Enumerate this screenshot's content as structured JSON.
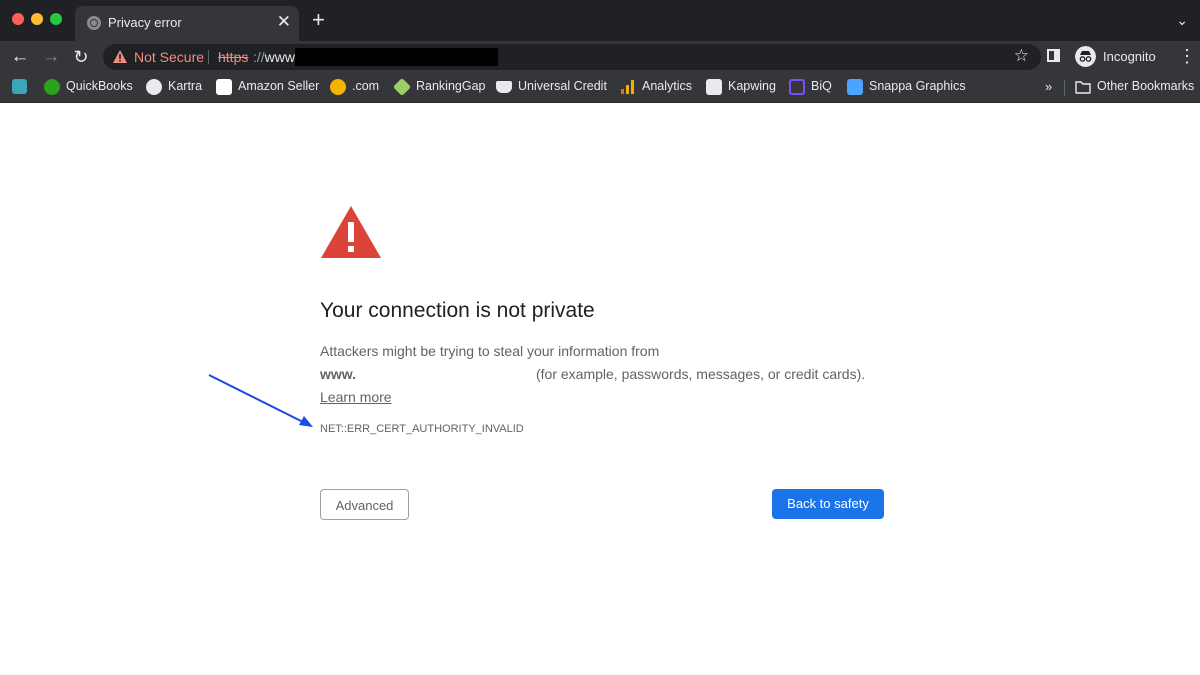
{
  "tab": {
    "title": "Privacy error",
    "close": "✕",
    "new_tab": "+",
    "tab_search": "⌄"
  },
  "toolbar": {
    "not_secure": "Not Secure",
    "url_scheme": "https",
    "url_sep": "://",
    "url_host": "www.",
    "incognito": "Incognito"
  },
  "bookmarks": {
    "items": [
      {
        "label": "",
        "icon": "app-icon",
        "color": "#3aa6b9"
      },
      {
        "label": "QuickBooks",
        "icon": "quickbooks-icon",
        "color": "#2ca01c"
      },
      {
        "label": "Kartra",
        "icon": "kartra-icon",
        "color": "#e8eaed"
      },
      {
        "label": "Amazon Seller",
        "icon": "amazon-icon",
        "color": "#ffffff"
      },
      {
        "label": ".com",
        "icon": "globe-icon",
        "color": "#f4b400"
      },
      {
        "label": "RankingGap",
        "icon": "rankinggap-icon",
        "color": "#9ccc65"
      },
      {
        "label": "Universal Credit",
        "icon": "crown-icon",
        "color": "#e8eaed"
      },
      {
        "label": "Analytics",
        "icon": "analytics-icon",
        "color": "#f9ab00"
      },
      {
        "label": "Kapwing",
        "icon": "kapwing-icon",
        "color": "#e8eaed"
      },
      {
        "label": "BiQ",
        "icon": "biq-icon",
        "color": "#7c4dff"
      },
      {
        "label": "Snappa Graphics",
        "icon": "snappa-icon",
        "color": "#4da3ff"
      }
    ],
    "more": "»",
    "other": "Other Bookmarks"
  },
  "page": {
    "heading": "Your connection is not private",
    "desc_line1": "Attackers might be trying to steal your information from",
    "desc_host": "www.",
    "desc_line2": "(for example, passwords, messages, or credit cards).",
    "learn_more": "Learn more",
    "error_code": "NET::ERR_CERT_AUTHORITY_INVALID",
    "advanced": "Advanced",
    "back_to_safety": "Back to safety"
  },
  "colors": {
    "accent": "#1a73e8",
    "warning": "#db4437",
    "annotation_arrow": "#1a4be8"
  }
}
